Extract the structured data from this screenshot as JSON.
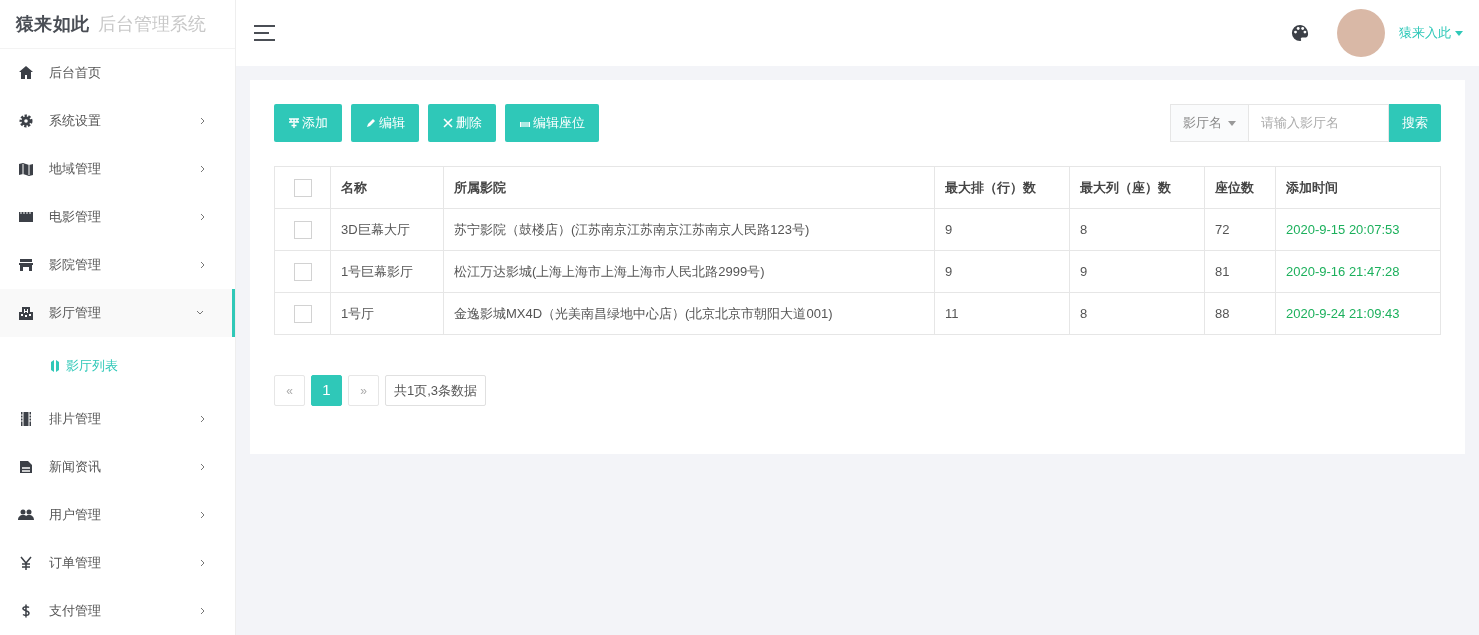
{
  "logo": {
    "brand": "猿来如此",
    "subtitle": "后台管理系统"
  },
  "header": {
    "user": "猿来入此"
  },
  "sidebar": {
    "items": [
      {
        "label": "后台首页",
        "has_arrow": false,
        "expanded": false
      },
      {
        "label": "系统设置",
        "has_arrow": true,
        "expanded": false
      },
      {
        "label": "地域管理",
        "has_arrow": true,
        "expanded": false
      },
      {
        "label": "电影管理",
        "has_arrow": true,
        "expanded": false
      },
      {
        "label": "影院管理",
        "has_arrow": true,
        "expanded": false
      },
      {
        "label": "影厅管理",
        "has_arrow": true,
        "expanded": true,
        "children": [
          {
            "label": "影厅列表",
            "selected": true
          }
        ]
      },
      {
        "label": "排片管理",
        "has_arrow": true,
        "expanded": false
      },
      {
        "label": "新闻资讯",
        "has_arrow": true,
        "expanded": false
      },
      {
        "label": "用户管理",
        "has_arrow": true,
        "expanded": false
      },
      {
        "label": "订单管理",
        "has_arrow": true,
        "expanded": false
      },
      {
        "label": "支付管理",
        "has_arrow": true,
        "expanded": false
      }
    ]
  },
  "toolbar": {
    "buttons": [
      "添加",
      "编辑",
      "删除",
      "编辑座位"
    ]
  },
  "search": {
    "field_select": "影厅名",
    "placeholder": "请输入影厅名",
    "button": "搜索"
  },
  "table": {
    "select_all_checked": false,
    "columns": [
      "名称",
      "所属影院",
      "最大排（行）数",
      "最大列（座）数",
      "座位数",
      "添加时间"
    ],
    "rows": [
      {
        "checked": false,
        "cells": [
          "3D巨幕大厅",
          "苏宁影院（鼓楼店）(江苏南京江苏南京江苏南京人民路123号)",
          "9",
          "8",
          "72",
          "2020-9-15 20:07:53"
        ]
      },
      {
        "checked": false,
        "cells": [
          "1号巨幕影厅",
          "松江万达影城(上海上海市上海上海市人民北路2999号)",
          "9",
          "9",
          "81",
          "2020-9-16 21:47:28"
        ]
      },
      {
        "checked": false,
        "cells": [
          "1号厅",
          "金逸影城MX4D（光美南昌绿地中心店）(北京北京市朝阳大道001)",
          "11",
          "8",
          "88",
          "2020-9-24 21:09:43"
        ]
      }
    ]
  },
  "pagination": {
    "prev": "«",
    "pages": [
      {
        "label": "1",
        "selected": true
      }
    ],
    "next": "»",
    "summary": "共1页,3条数据"
  }
}
